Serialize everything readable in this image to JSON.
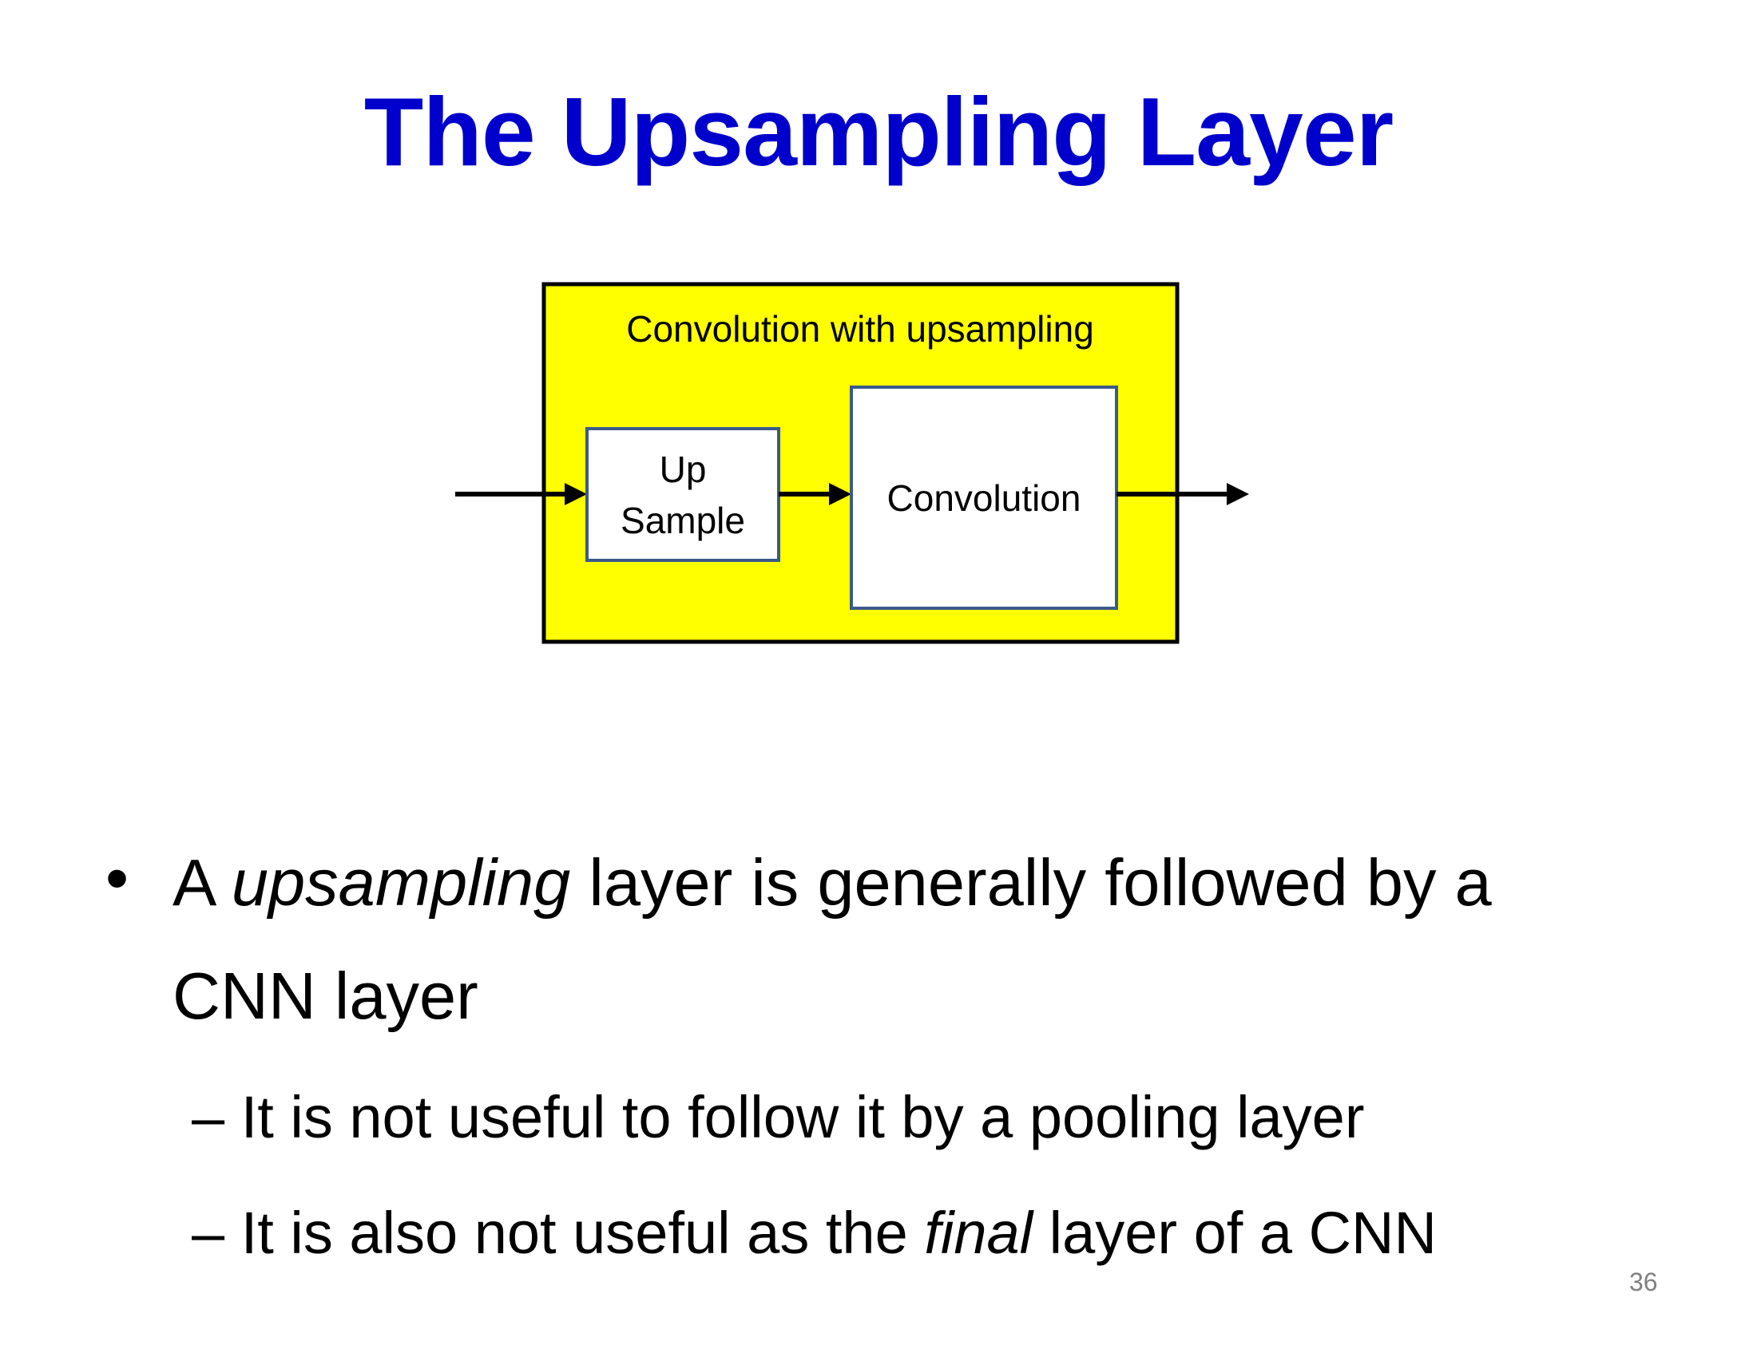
{
  "slide": {
    "title": "The Upsampling Layer",
    "page_number": "36"
  },
  "diagram": {
    "outer_label": "Convolution with upsampling",
    "upsample_line1": "Up",
    "upsample_line2": "Sample",
    "conv_label": "Convolution",
    "colors": {
      "outer_fill": "#ffff00",
      "outer_stroke": "#000000",
      "inner_fill": "#ffffff",
      "inner_stroke": "#3a5a8a",
      "arrow": "#000000"
    }
  },
  "bullets": {
    "main_pre": "A ",
    "main_em": "upsampling",
    "main_post": " layer is generally followed by a",
    "main_line2": "CNN layer",
    "sub1": "– It is not useful to follow it by a pooling layer",
    "sub2_pre": "– It is also not useful as the ",
    "sub2_em": "final",
    "sub2_post": " layer of a CNN"
  }
}
